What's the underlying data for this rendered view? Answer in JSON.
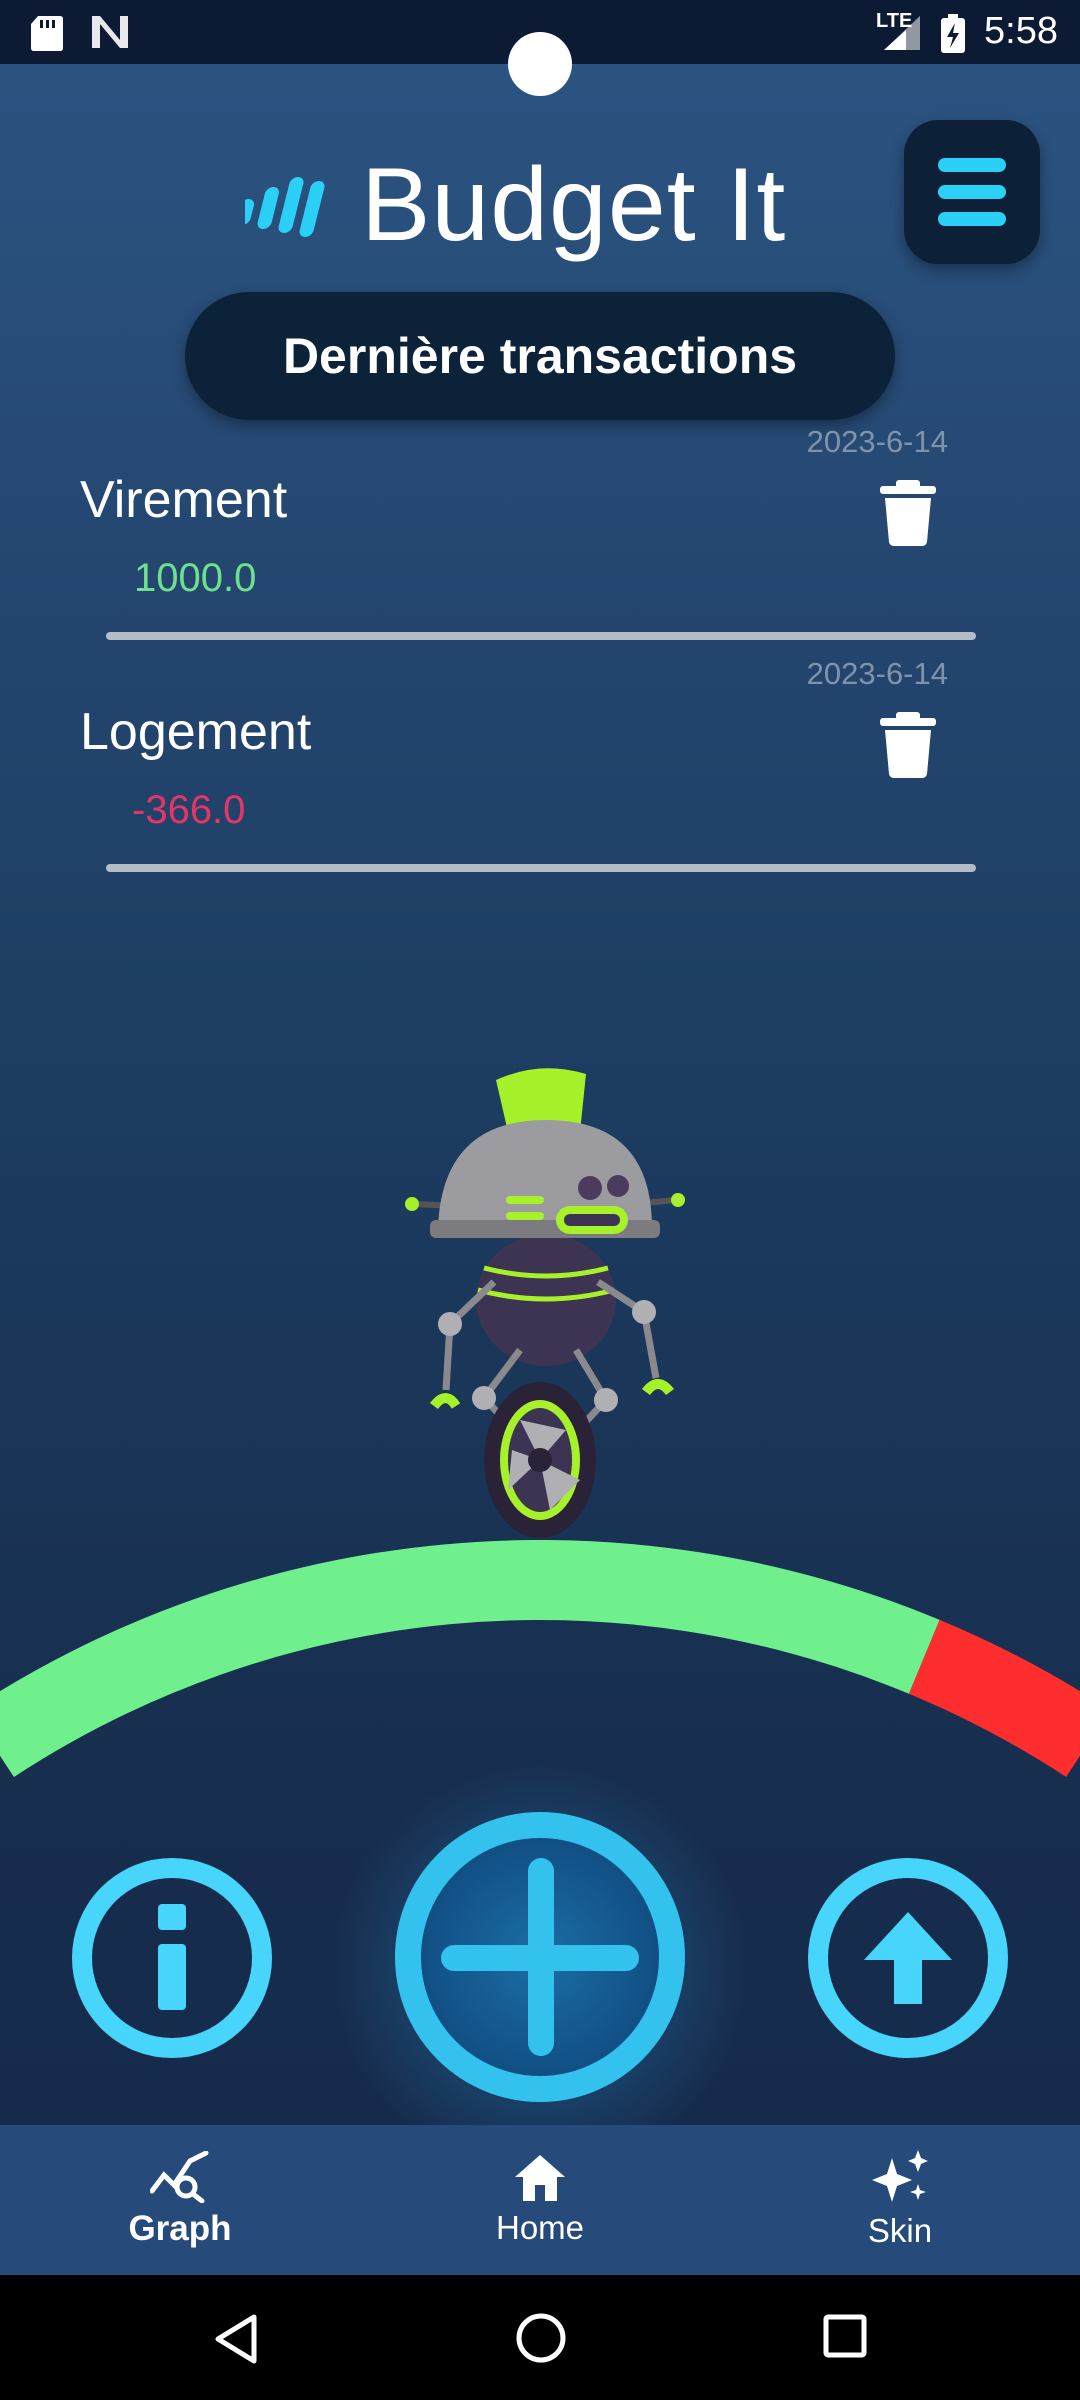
{
  "status_bar": {
    "time": "5:58",
    "network": "LTE",
    "icons": [
      "sd-card-icon",
      "n-notification-icon",
      "lte-signal-icon",
      "battery-charging-icon"
    ]
  },
  "header": {
    "app_title": "Budget It",
    "logo_icon": "budget-logo-bars-icon",
    "menu_icon": "hamburger-menu-icon"
  },
  "section": {
    "title": "Dernière transactions"
  },
  "transactions": [
    {
      "date": "2023-6-14",
      "label": "Virement",
      "amount": "1000.0",
      "type": "income"
    },
    {
      "date": "2023-6-14",
      "label": "Logement",
      "amount": "-366.0",
      "type": "expense"
    }
  ],
  "gauge": {
    "colors": {
      "ok": "#6ff08c",
      "over": "#ff2e2e"
    },
    "ok_fraction": 0.84
  },
  "actions": {
    "info_icon": "info-icon",
    "add_icon": "plus-icon",
    "upload_icon": "arrow-up-icon"
  },
  "bottom_nav": {
    "items": [
      {
        "label": "Graph",
        "icon": "graph-search-icon",
        "active": true
      },
      {
        "label": "Home",
        "icon": "home-icon",
        "active": false
      },
      {
        "label": "Skin",
        "icon": "sparkles-icon",
        "active": false
      }
    ]
  },
  "colors": {
    "accent": "#33c2ee",
    "income": "#6fe08e",
    "expense": "#e53567"
  }
}
